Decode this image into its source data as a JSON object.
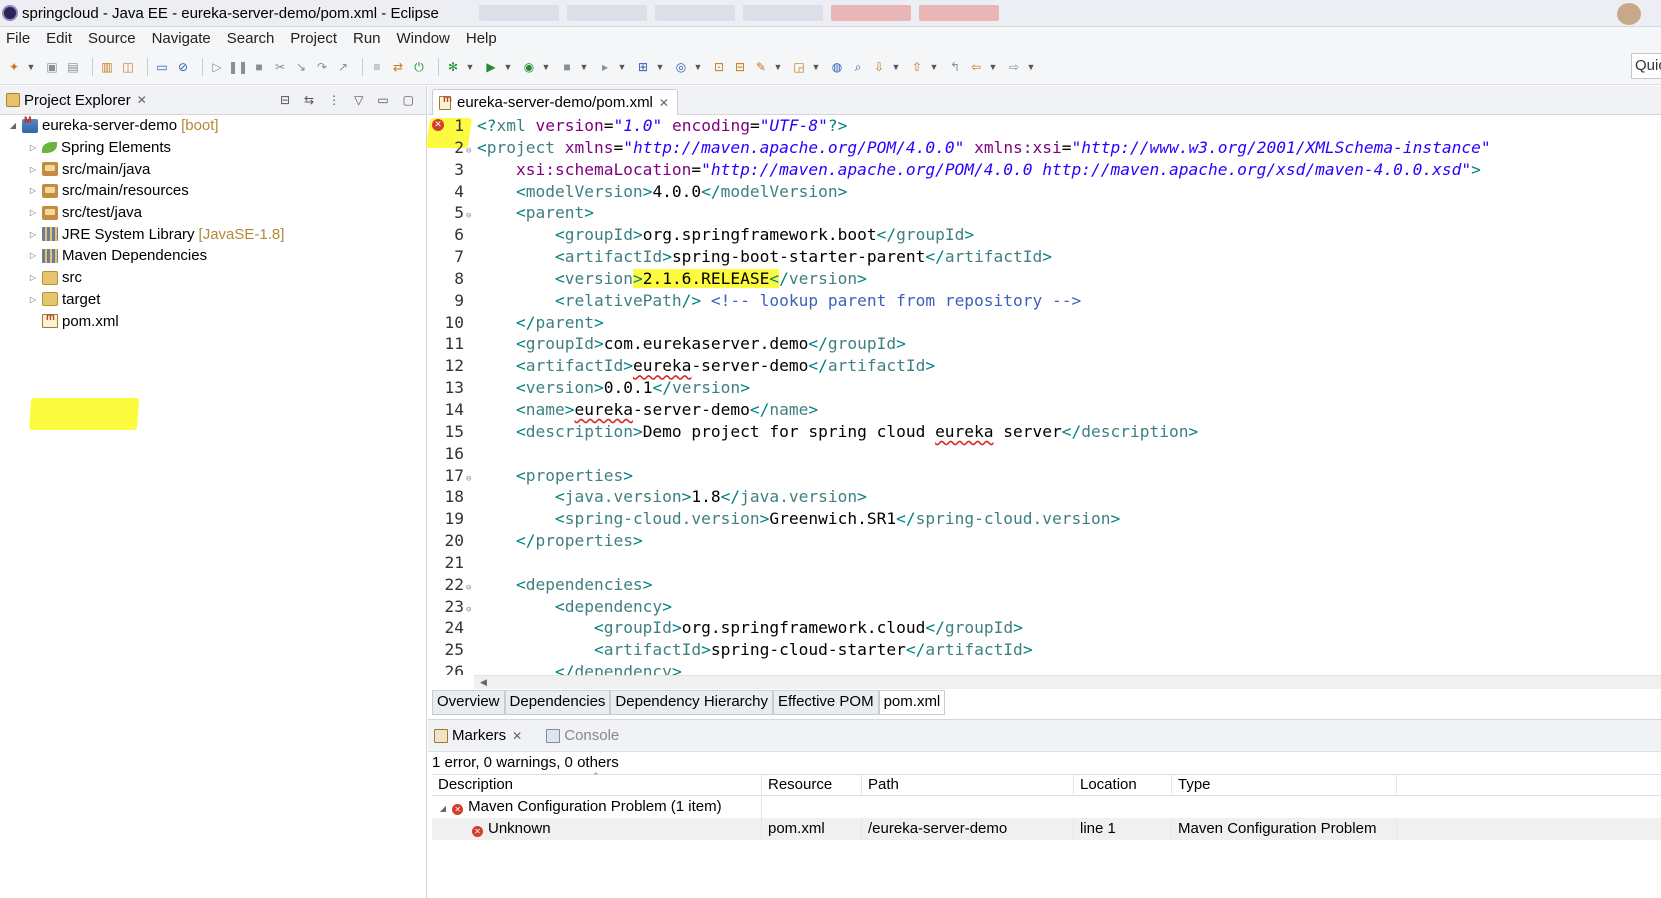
{
  "window": {
    "title": "springcloud - Java EE - eureka-server-demo/pom.xml - Eclipse"
  },
  "menubar": {
    "items": [
      "File",
      "Edit",
      "Source",
      "Navigate",
      "Search",
      "Project",
      "Run",
      "Window",
      "Help"
    ]
  },
  "toolbar": {
    "quick_access_label": "Quic"
  },
  "project_explorer": {
    "title": "Project Explorer",
    "tree": [
      {
        "label": "eureka-server-demo",
        "decoration": "[boot]",
        "icon": "maven-project-icon",
        "depth": 0,
        "expanded": true
      },
      {
        "label": "Spring Elements",
        "decoration": "",
        "icon": "spring-leaf-icon",
        "depth": 1,
        "expanded": false
      },
      {
        "label": "src/main/java",
        "decoration": "",
        "icon": "source-folder-icon",
        "depth": 1,
        "expanded": false
      },
      {
        "label": "src/main/resources",
        "decoration": "",
        "icon": "source-folder-icon",
        "depth": 1,
        "expanded": false
      },
      {
        "label": "src/test/java",
        "decoration": "",
        "icon": "source-folder-icon",
        "depth": 1,
        "expanded": false
      },
      {
        "label": "JRE System Library",
        "decoration": "[JavaSE-1.8]",
        "icon": "library-icon",
        "depth": 1,
        "expanded": false
      },
      {
        "label": "Maven Dependencies",
        "decoration": "",
        "icon": "library-icon",
        "depth": 1,
        "expanded": false
      },
      {
        "label": "src",
        "decoration": "",
        "icon": "folder-icon",
        "depth": 1,
        "expanded": false
      },
      {
        "label": "target",
        "decoration": "",
        "icon": "folder-icon",
        "depth": 1,
        "expanded": false
      },
      {
        "label": "pom.xml",
        "decoration": "",
        "icon": "xml-file-icon",
        "depth": 1,
        "expanded": null
      }
    ]
  },
  "editor": {
    "tab_label": "eureka-server-demo/pom.xml",
    "error_line": 1,
    "lines": [
      {
        "n": "1",
        "html": "<span class=\"pun\">&lt;?</span><span class=\"tag\">xml</span> <span class=\"attr\">version</span>=<span class=\"str\">\"1.0\"</span> <span class=\"attr\">encoding</span>=<span class=\"str\">\"UTF-8\"</span><span class=\"pun\">?&gt;</span>"
      },
      {
        "n": "2",
        "fold": true,
        "html": "<span class=\"pun\">&lt;</span><span class=\"tag\">project</span> <span class=\"attr\">xmlns</span>=<span class=\"str\">\"http://maven.apache.org/POM/4.0.0\"</span> <span class=\"attr\">xmlns:xsi</span>=<span class=\"str\">\"http://www.w3.org/2001/XMLSchema-instance\"</span>"
      },
      {
        "n": "3",
        "html": "    <span class=\"attr\">xsi:schemaLocation</span>=<span class=\"str\">\"http://maven.apache.org/POM/4.0.0 http://maven.apache.org/xsd/maven-4.0.0.xsd\"</span><span class=\"pun\">&gt;</span>"
      },
      {
        "n": "4",
        "html": "    <span class=\"pun\">&lt;</span><span class=\"tag\">modelVersion</span><span class=\"pun\">&gt;</span>4.0.0<span class=\"pun\">&lt;/</span><span class=\"tag\">modelVersion</span><span class=\"pun\">&gt;</span>"
      },
      {
        "n": "5",
        "fold": true,
        "html": "    <span class=\"pun\">&lt;</span><span class=\"tag\">parent</span><span class=\"pun\">&gt;</span>"
      },
      {
        "n": "6",
        "html": "        <span class=\"pun\">&lt;</span><span class=\"tag\">groupId</span><span class=\"pun\">&gt;</span>org.springframework.boot<span class=\"pun\">&lt;/</span><span class=\"tag\">groupId</span><span class=\"pun\">&gt;</span>"
      },
      {
        "n": "7",
        "html": "        <span class=\"pun\">&lt;</span><span class=\"tag\">artifactId</span><span class=\"pun\">&gt;</span>spring-boot-starter-parent<span class=\"pun\">&lt;/</span><span class=\"tag\">artifactId</span><span class=\"pun\">&gt;</span>"
      },
      {
        "n": "8",
        "html": "        <span class=\"pun\">&lt;</span><span class=\"tag\">version</span><span class=\"pun hl\">&gt;</span><span class=\"hl\">2.1.6.RELEASE</span><span class=\"pun hl\">&lt;</span><span class=\"pun\">/</span><span class=\"tag\">version</span><span class=\"pun\">&gt;</span>"
      },
      {
        "n": "9",
        "html": "        <span class=\"pun\">&lt;</span><span class=\"tag\">relativePath</span><span class=\"pun\">/&gt;</span> <span class=\"cmt\">&lt;!-- lookup parent from repository --&gt;</span>"
      },
      {
        "n": "10",
        "html": "    <span class=\"pun\">&lt;/</span><span class=\"tag\">parent</span><span class=\"pun\">&gt;</span>"
      },
      {
        "n": "11",
        "html": "    <span class=\"pun\">&lt;</span><span class=\"tag\">groupId</span><span class=\"pun\">&gt;</span>com.eurekaserver.demo<span class=\"pun\">&lt;/</span><span class=\"tag\">groupId</span><span class=\"pun\">&gt;</span>"
      },
      {
        "n": "12",
        "html": "    <span class=\"pun\">&lt;</span><span class=\"tag\">artifactId</span><span class=\"pun\">&gt;</span><span class=\"squig\">eureka</span>-server-demo<span class=\"pun\">&lt;/</span><span class=\"tag\">artifactId</span><span class=\"pun\">&gt;</span>"
      },
      {
        "n": "13",
        "html": "    <span class=\"pun\">&lt;</span><span class=\"tag\">version</span><span class=\"pun\">&gt;</span>0.0.1<span class=\"pun\">&lt;/</span><span class=\"tag\">version</span><span class=\"pun\">&gt;</span>"
      },
      {
        "n": "14",
        "html": "    <span class=\"pun\">&lt;</span><span class=\"tag\">name</span><span class=\"pun\">&gt;</span><span class=\"squig\">eureka</span>-server-demo<span class=\"pun\">&lt;/</span><span class=\"tag\">name</span><span class=\"pun\">&gt;</span>"
      },
      {
        "n": "15",
        "html": "    <span class=\"pun\">&lt;</span><span class=\"tag\">description</span><span class=\"pun\">&gt;</span>Demo project for spring cloud <span class=\"squig\">eureka</span> server<span class=\"pun\">&lt;/</span><span class=\"tag\">description</span><span class=\"pun\">&gt;</span>"
      },
      {
        "n": "16",
        "html": ""
      },
      {
        "n": "17",
        "fold": true,
        "html": "    <span class=\"pun\">&lt;</span><span class=\"tag\">properties</span><span class=\"pun\">&gt;</span>"
      },
      {
        "n": "18",
        "html": "        <span class=\"pun\">&lt;</span><span class=\"tag\">java.version</span><span class=\"pun\">&gt;</span>1.8<span class=\"pun\">&lt;/</span><span class=\"tag\">java.version</span><span class=\"pun\">&gt;</span>"
      },
      {
        "n": "19",
        "html": "        <span class=\"pun\">&lt;</span><span class=\"tag\">spring-cloud.version</span><span class=\"pun\">&gt;</span>Greenwich.SR1<span class=\"pun\">&lt;/</span><span class=\"tag\">spring-cloud.version</span><span class=\"pun\">&gt;</span>"
      },
      {
        "n": "20",
        "html": "    <span class=\"pun\">&lt;/</span><span class=\"tag\">properties</span><span class=\"pun\">&gt;</span>"
      },
      {
        "n": "21",
        "html": ""
      },
      {
        "n": "22",
        "fold": true,
        "html": "    <span class=\"pun\">&lt;</span><span class=\"tag\">dependencies</span><span class=\"pun\">&gt;</span>"
      },
      {
        "n": "23",
        "fold": true,
        "html": "        <span class=\"pun\">&lt;</span><span class=\"tag\">dependency</span><span class=\"pun\">&gt;</span>"
      },
      {
        "n": "24",
        "html": "            <span class=\"pun\">&lt;</span><span class=\"tag\">groupId</span><span class=\"pun\">&gt;</span>org.springframework.cloud<span class=\"pun\">&lt;/</span><span class=\"tag\">groupId</span><span class=\"pun\">&gt;</span>"
      },
      {
        "n": "25",
        "html": "            <span class=\"pun\">&lt;</span><span class=\"tag\">artifactId</span><span class=\"pun\">&gt;</span>spring-cloud-starter<span class=\"pun\">&lt;/</span><span class=\"tag\">artifactId</span><span class=\"pun\">&gt;</span>"
      },
      {
        "n": "26",
        "html": "        <span class=\"pun\">&lt;/</span><span class=\"tag\">dependency</span><span class=\"pun\">&gt;</span>"
      }
    ],
    "pom_tabs": [
      "Overview",
      "Dependencies",
      "Dependency Hierarchy",
      "Effective POM",
      "pom.xml"
    ],
    "active_pom_tab": "pom.xml"
  },
  "markers": {
    "tab_markers": "Markers",
    "tab_console": "Console",
    "summary": "1 error, 0 warnings, 0 others",
    "columns": [
      "Description",
      "Resource",
      "Path",
      "Location",
      "Type"
    ],
    "group": {
      "label": "Maven Configuration Problem (1 item)"
    },
    "rows": [
      {
        "description": "Unknown",
        "resource": "pom.xml",
        "path": "/eureka-server-demo",
        "location": "line 1",
        "type": "Maven Configuration Problem"
      }
    ]
  },
  "colors": {
    "highlight": "#fdfb40",
    "error": "#d63b2b",
    "xml_tag": "#3f7f7f",
    "xml_attr": "#7f007f",
    "xml_string": "#2a00ff",
    "xml_comment": "#3f5fbf"
  }
}
